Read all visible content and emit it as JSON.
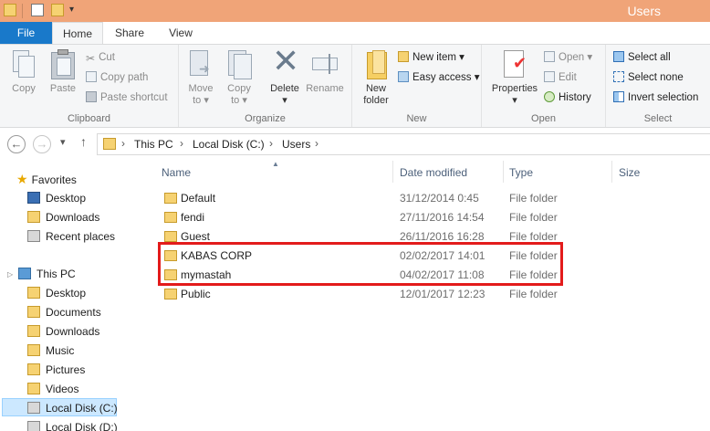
{
  "window": {
    "title": "Users"
  },
  "tabs": [
    "File",
    "Home",
    "Share",
    "View"
  ],
  "ribbon": {
    "clipboard": {
      "label": "Clipboard",
      "copy": "Copy",
      "paste": "Paste",
      "cut": "Cut",
      "copy_path": "Copy path",
      "paste_shortcut": "Paste shortcut"
    },
    "organize": {
      "label": "Organize",
      "move_to": [
        "Move",
        "to"
      ],
      "copy_to": [
        "Copy",
        "to"
      ],
      "delete": "Delete",
      "rename": "Rename"
    },
    "new": {
      "label": "New",
      "new_folder": [
        "New",
        "folder"
      ],
      "new_item": "New item",
      "easy_access": "Easy access"
    },
    "open": {
      "label": "Open",
      "properties": "Properties",
      "open": "Open",
      "edit": "Edit",
      "history": "History"
    },
    "select": {
      "label": "Select",
      "select_all": "Select all",
      "select_none": "Select none",
      "invert": "Invert selection"
    }
  },
  "address": {
    "crumbs": [
      "This PC",
      "Local Disk (C:)",
      "Users"
    ]
  },
  "nav": {
    "favorites": "Favorites",
    "favorites_items": [
      "Desktop",
      "Downloads",
      "Recent places"
    ],
    "this_pc": "This PC",
    "this_pc_items": [
      "Desktop",
      "Documents",
      "Downloads",
      "Music",
      "Pictures",
      "Videos",
      "Local Disk (C:)",
      "Local Disk (D:)"
    ]
  },
  "columns": {
    "name": "Name",
    "date": "Date modified",
    "type": "Type",
    "size": "Size"
  },
  "files": [
    {
      "name": "Default",
      "date": "31/12/2014 0:45",
      "type": "File folder"
    },
    {
      "name": "fendi",
      "date": "27/11/2016 14:54",
      "type": "File folder"
    },
    {
      "name": "Guest",
      "date": "26/11/2016 16:28",
      "type": "File folder"
    },
    {
      "name": "KABAS CORP",
      "date": "02/02/2017 14:01",
      "type": "File folder"
    },
    {
      "name": "mymastah",
      "date": "04/02/2017 11:08",
      "type": "File folder"
    },
    {
      "name": "Public",
      "date": "12/01/2017 12:23",
      "type": "File folder"
    }
  ],
  "colors": {
    "titlebar": "#f0a478",
    "file_tab": "#1979ca",
    "highlight": "#e31b1b"
  }
}
